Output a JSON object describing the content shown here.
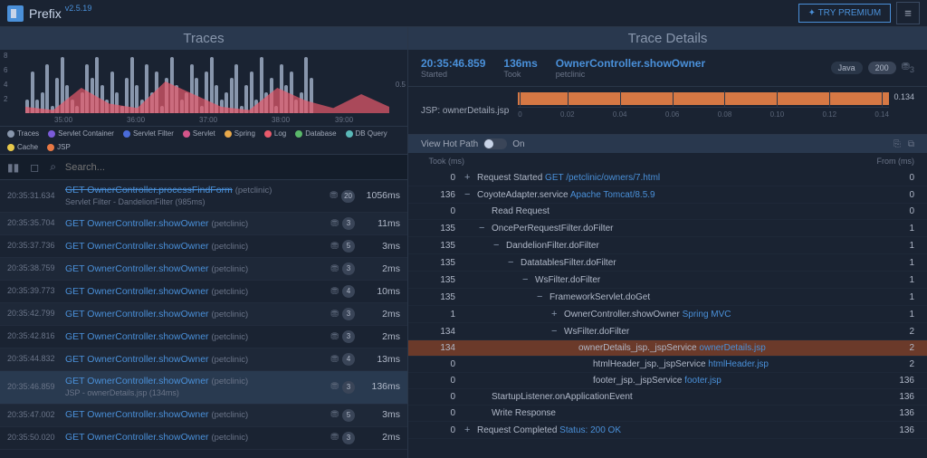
{
  "app": {
    "name": "Prefix",
    "version": "v2.5.19"
  },
  "header": {
    "premium": "✦ TRY PREMIUM",
    "menu": "≡"
  },
  "traces_panel": {
    "title": "Traces",
    "y_ticks": [
      "8",
      "6",
      "4",
      "2"
    ],
    "x_ticks": [
      "35:00",
      "36:00",
      "37:00",
      "38:00",
      "39:00"
    ],
    "y_right": "0.5",
    "legend": [
      {
        "label": "Traces",
        "color": "#8896ac"
      },
      {
        "label": "Servlet Container",
        "color": "#7b5bd9"
      },
      {
        "label": "Servlet Filter",
        "color": "#4a6bd9"
      },
      {
        "label": "Servlet",
        "color": "#d4558a"
      },
      {
        "label": "Spring",
        "color": "#e8a84a"
      },
      {
        "label": "Log",
        "color": "#e85a6b"
      },
      {
        "label": "Database",
        "color": "#5ab86a"
      },
      {
        "label": "DB Query",
        "color": "#5ab8b8"
      },
      {
        "label": "Cache",
        "color": "#e8c84a"
      },
      {
        "label": "JSP",
        "color": "#e87844"
      }
    ],
    "search_placeholder": "Search...",
    "rows": [
      {
        "time": "20:35:31.634",
        "name": "GET OwnerController.processFindForm",
        "ctx": "(petclinic)",
        "sub": "Servlet Filter - DandelionFilter (985ms)",
        "badge": "20",
        "dur": "1056ms",
        "alt": false,
        "sel": false,
        "truncated": true
      },
      {
        "time": "20:35:35.704",
        "name": "GET OwnerController.showOwner",
        "ctx": "(petclinic)",
        "badge": "3",
        "dur": "11ms",
        "alt": true
      },
      {
        "time": "20:35:37.736",
        "name": "GET OwnerController.showOwner",
        "ctx": "(petclinic)",
        "badge": "5",
        "dur": "3ms",
        "alt": false
      },
      {
        "time": "20:35:38.759",
        "name": "GET OwnerController.showOwner",
        "ctx": "(petclinic)",
        "badge": "3",
        "dur": "2ms",
        "alt": true
      },
      {
        "time": "20:35:39.773",
        "name": "GET OwnerController.showOwner",
        "ctx": "(petclinic)",
        "badge": "4",
        "dur": "10ms",
        "alt": false
      },
      {
        "time": "20:35:42.799",
        "name": "GET OwnerController.showOwner",
        "ctx": "(petclinic)",
        "badge": "3",
        "dur": "2ms",
        "alt": true
      },
      {
        "time": "20:35:42.816",
        "name": "GET OwnerController.showOwner",
        "ctx": "(petclinic)",
        "badge": "3",
        "dur": "2ms",
        "alt": false
      },
      {
        "time": "20:35:44.832",
        "name": "GET OwnerController.showOwner",
        "ctx": "(petclinic)",
        "badge": "4",
        "dur": "13ms",
        "alt": true
      },
      {
        "time": "20:35:46.859",
        "name": "GET OwnerController.showOwner",
        "ctx": "(petclinic)",
        "sub": "JSP - ownerDetails.jsp (134ms)",
        "badge": "3",
        "dur": "136ms",
        "alt": false,
        "sel": true
      },
      {
        "time": "20:35:47.002",
        "name": "GET OwnerController.showOwner",
        "ctx": "(petclinic)",
        "badge": "5",
        "dur": "3ms",
        "alt": true
      },
      {
        "time": "20:35:50.020",
        "name": "GET OwnerController.showOwner",
        "ctx": "(petclinic)",
        "badge": "3",
        "dur": "2ms",
        "alt": false
      }
    ]
  },
  "details": {
    "title": "Trace Details",
    "started": {
      "val": "20:35:46.859",
      "lbl": "Started"
    },
    "took": {
      "val": "136ms",
      "lbl": "Took"
    },
    "action": {
      "val": "OwnerController.showOwner",
      "lbl": "petclinic"
    },
    "badges": {
      "lang": "Java",
      "status": "200",
      "db": "3"
    },
    "timeline_label": "JSP: ownerDetails.jsp",
    "timeline_end": "0.134",
    "timeline_ticks": [
      "0",
      "0.02",
      "0.04",
      "0.06",
      "0.08",
      "0.10",
      "0.12",
      "0.14"
    ],
    "hotpath": {
      "label": "View Hot Path",
      "state": "On"
    },
    "cols": {
      "took": "Took (ms)",
      "from": "From (ms)"
    },
    "tree": [
      {
        "ms": "0",
        "exp": "+",
        "indent": 0,
        "text": "Request Started  ",
        "link": "GET /petclinic/owners/7.html",
        "from": "0"
      },
      {
        "ms": "136",
        "exp": "−",
        "indent": 0,
        "text": "CoyoteAdapter.service  ",
        "link": "Apache Tomcat/8.5.9",
        "from": "0"
      },
      {
        "ms": "0",
        "exp": "",
        "indent": 1,
        "text": "Read Request",
        "from": "0"
      },
      {
        "ms": "135",
        "exp": "−",
        "indent": 1,
        "text": "OncePerRequestFilter.doFilter",
        "from": "1"
      },
      {
        "ms": "135",
        "exp": "−",
        "indent": 2,
        "text": "DandelionFilter.doFilter",
        "from": "1"
      },
      {
        "ms": "135",
        "exp": "−",
        "indent": 3,
        "text": "DatatablesFilter.doFilter",
        "from": "1"
      },
      {
        "ms": "135",
        "exp": "−",
        "indent": 4,
        "text": "WsFilter.doFilter",
        "from": "1"
      },
      {
        "ms": "135",
        "exp": "−",
        "indent": 5,
        "text": "FrameworkServlet.doGet",
        "from": "1"
      },
      {
        "ms": "1",
        "exp": "+",
        "indent": 6,
        "text": "OwnerController.showOwner  ",
        "link": "Spring MVC",
        "from": "1"
      },
      {
        "ms": "134",
        "exp": "−",
        "indent": 6,
        "text": "WsFilter.doFilter",
        "from": "2"
      },
      {
        "ms": "134",
        "exp": "",
        "indent": 7,
        "text": "ownerDetails_jsp._jspService  ",
        "link": "ownerDetails.jsp",
        "from": "2",
        "hl": true
      },
      {
        "ms": "0",
        "exp": "",
        "indent": 8,
        "text": "htmlHeader_jsp._jspService  ",
        "link": "htmlHeader.jsp",
        "from": "2"
      },
      {
        "ms": "0",
        "exp": "",
        "indent": 8,
        "text": "footer_jsp._jspService  ",
        "link": "footer.jsp",
        "from": "136"
      },
      {
        "ms": "0",
        "exp": "",
        "indent": 1,
        "text": "StartupListener.onApplicationEvent",
        "from": "136"
      },
      {
        "ms": "0",
        "exp": "",
        "indent": 1,
        "text": "Write Response",
        "from": "136"
      },
      {
        "ms": "0",
        "exp": "+",
        "indent": 0,
        "text": "Request Completed  ",
        "link": "Status: 200 OK",
        "from": "136"
      }
    ]
  },
  "chart_data": {
    "type": "bar",
    "ylim": [
      0,
      8
    ],
    "bars": [
      2,
      6,
      2,
      3,
      7,
      1,
      5,
      8,
      4,
      2,
      1,
      3,
      7,
      5,
      8,
      4,
      2,
      6,
      3,
      1,
      5,
      8,
      4,
      2,
      7,
      3,
      6,
      1,
      5,
      8,
      4,
      2,
      3,
      7,
      5,
      1,
      6,
      8,
      4,
      2,
      3,
      5,
      7,
      1,
      4,
      6,
      2,
      8,
      3,
      5,
      1,
      7,
      4,
      6,
      2,
      3,
      8,
      5
    ],
    "area_peaks": [
      0.1,
      0.05,
      0.4,
      0.15,
      0.08,
      0.5,
      0.3,
      0.1,
      0.05,
      0.4,
      0.2,
      0.08,
      0.3,
      0.1
    ]
  }
}
